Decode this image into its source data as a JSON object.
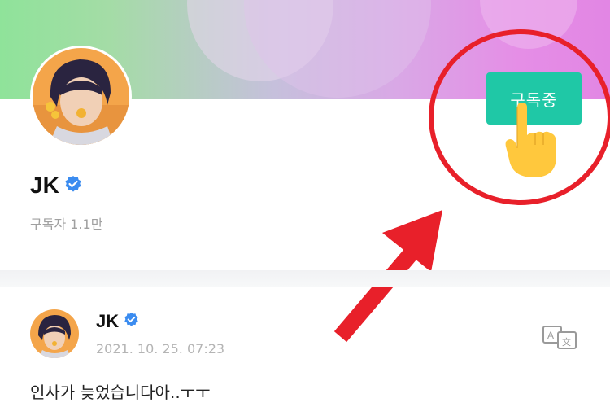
{
  "profile": {
    "name": "JK",
    "subscribers": "구독자 1.1만",
    "subscribe_label": "구독중"
  },
  "post": {
    "author": "JK",
    "timestamp": "2021. 10. 25. 07:23",
    "text": "인사가 늦었습니다아..ㅜㅜ"
  },
  "icons": [
    "verified-badge-icon",
    "translate-icon",
    "pointing-hand-icon",
    "red-arrow-icon"
  ],
  "colors": {
    "subscribe_button": "#1fc8a6",
    "highlight": "#e8202a",
    "verified": "#3b8cf0"
  }
}
